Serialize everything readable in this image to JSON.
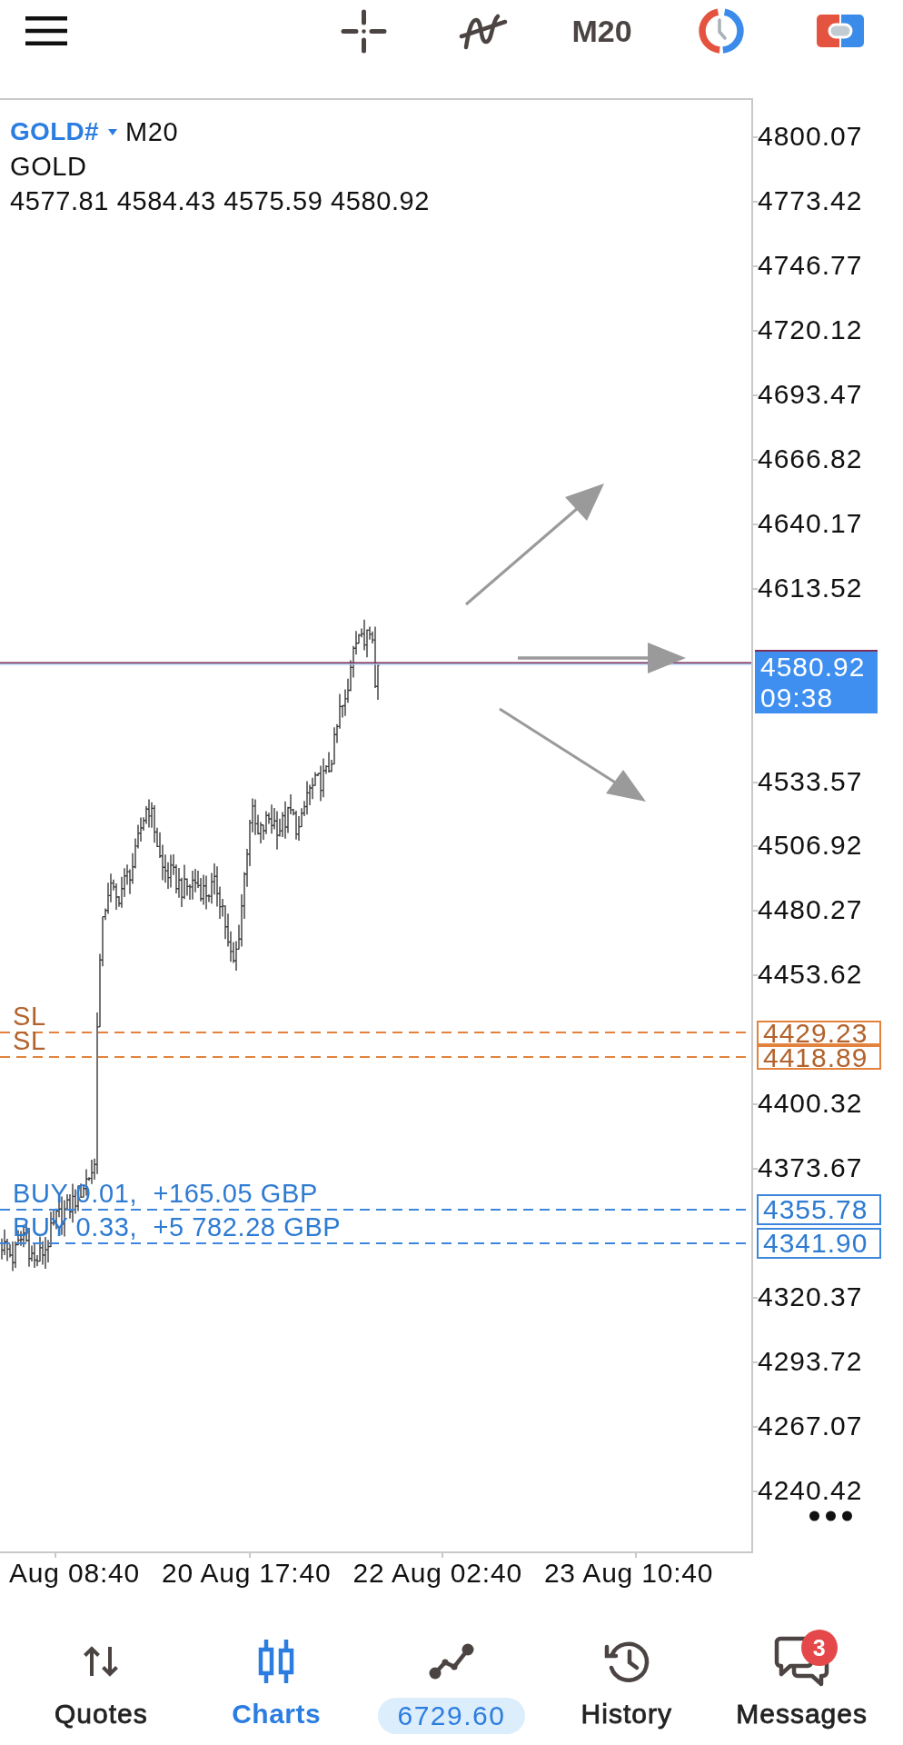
{
  "top_bar": {
    "timeframe": "M20"
  },
  "chart": {
    "symbol": "GOLD#",
    "timeframe": "M20",
    "description": "GOLD",
    "ohlc": "4577.81 4584.43 4575.59 4580.92",
    "current_price": {
      "price": "4580.92",
      "countdown": "09:38"
    },
    "levels": [
      {
        "kind": "stop_loss",
        "label": "SL",
        "price": "4429.23"
      },
      {
        "kind": "stop_loss",
        "label": "SL",
        "price": "4418.89"
      },
      {
        "kind": "position",
        "label": "BUY 0.01,  +165.05 GBP",
        "price": "4355.78"
      },
      {
        "kind": "position",
        "label": "BUY 0.33,  +5 782.28 GBP",
        "price": "4341.90"
      }
    ],
    "price_axis": [
      "4800.07",
      "4773.42",
      "4746.77",
      "4720.12",
      "4693.47",
      "4666.82",
      "4640.17",
      "4613.52",
      "4533.57",
      "4506.92",
      "4480.27",
      "4453.62",
      "4400.32",
      "4373.67",
      "4320.37",
      "4293.72",
      "4267.07",
      "4240.42"
    ],
    "time_axis": [
      "Aug 08:40",
      "20 Aug 17:40",
      "22 Aug 02:40",
      "23 Aug 10:40"
    ]
  },
  "nav": {
    "items": [
      {
        "kind": "tab",
        "label": "Quotes",
        "selected": false
      },
      {
        "kind": "tab",
        "label": "Charts",
        "selected": true
      },
      {
        "kind": "balance",
        "value": "6729.60",
        "selected": false
      },
      {
        "kind": "tab",
        "label": "History",
        "selected": false
      },
      {
        "kind": "tab",
        "label": "Messages",
        "selected": false,
        "badge": "3"
      }
    ]
  }
}
